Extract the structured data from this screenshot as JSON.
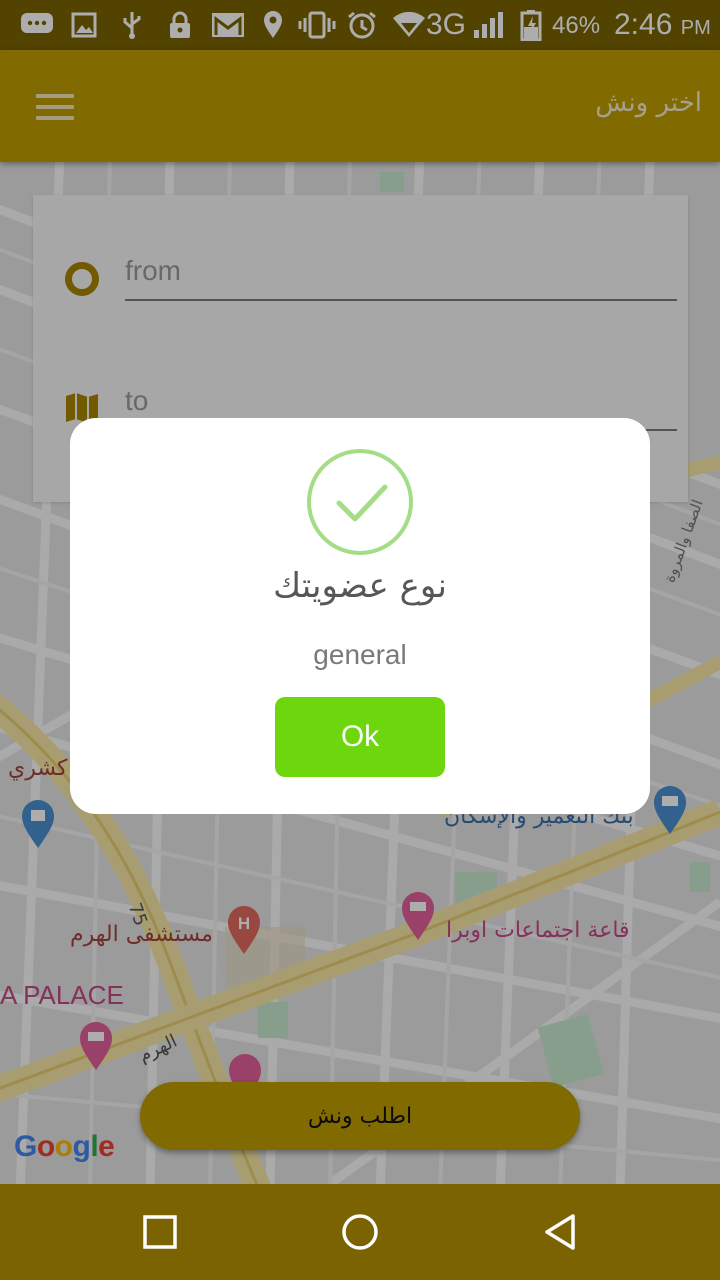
{
  "status_bar": {
    "network": "3G",
    "battery": "46%",
    "time": "2:46",
    "ampm": "PM"
  },
  "app_bar": {
    "title": "اختر ونش"
  },
  "route_form": {
    "from_placeholder": "from",
    "to_placeholder": "to"
  },
  "map": {
    "labels": {
      "hospital": "مستشفى الهرم",
      "hall": "قاعة اجتماعات اوبرا",
      "bank": "بنك التعمير والإسكان",
      "palace": "A PALACE",
      "koshary": "كشري",
      "road_number": "75",
      "haram_street": "الهرم",
      "side_street": "الصفا والمروة"
    },
    "attribution": "Google"
  },
  "dialog": {
    "title": "نوع عضويتك",
    "text": "general",
    "ok_label": "Ok"
  },
  "request_button": {
    "label": "اطلب ونش"
  },
  "colors": {
    "brand": "#bf9c00",
    "brand_dark": "#7a6300",
    "success": "#a5dc86",
    "ok_button": "#6ed60c"
  }
}
